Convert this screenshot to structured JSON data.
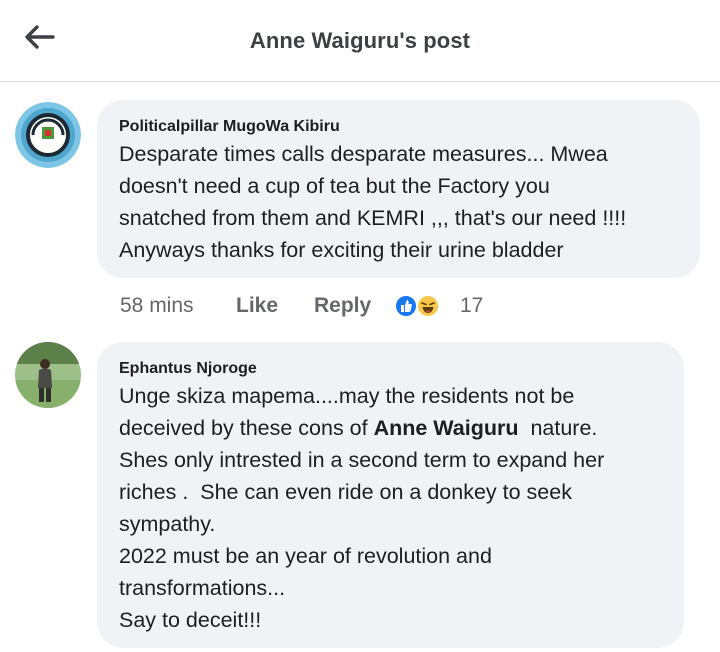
{
  "header": {
    "title": "Anne Waiguru's post",
    "back_icon": "arrow-left-icon"
  },
  "comments": [
    {
      "author": "Politicalpillar MugoWa Kibiru",
      "avatar": "political-badge-avatar",
      "lines": [
        "Desparate times calls desparate measures... Mwea",
        "doesn't need a cup of tea but the Factory you",
        "snatched from them and KEMRI ,,, that's our need !!!!",
        "Anyways thanks for exciting their urine bladder"
      ],
      "time": "58 mins",
      "like_label": "Like",
      "reply_label": "Reply",
      "reactions": [
        "like-icon",
        "haha-icon"
      ],
      "reaction_count": "17"
    },
    {
      "author": "Ephantus Njoroge",
      "avatar": "person-photo-avatar",
      "lines": [
        "Unge skiza mapema....may the residents not be",
        "deceived by these cons of ",
        "Anne Waiguru",
        "  nature.",
        "Shes only intrested in a second term to expand her",
        "riches .  She can even ride on a donkey to seek",
        "sympathy.",
        "2022 must be an year of revolution and",
        "transformations...",
        "Say to deceit!!!"
      ]
    }
  ],
  "colors": {
    "bubble": "#f0f2f5",
    "meta_text": "#65676b",
    "like_blue": "#1877f2",
    "haha_yellow": "#f7c84b"
  }
}
